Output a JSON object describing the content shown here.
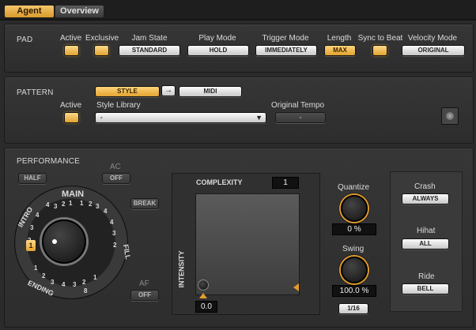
{
  "tabs": {
    "agent": "Agent",
    "overview": "Overview"
  },
  "pad": {
    "section_title": "PAD",
    "active_label": "Active",
    "exclusive_label": "Exclusive",
    "jam_state_label": "Jam State",
    "jam_state_value": "STANDARD",
    "play_mode_label": "Play Mode",
    "play_mode_value": "HOLD",
    "trigger_mode_label": "Trigger Mode",
    "trigger_mode_value": "IMMEDIATELY",
    "length_label": "Length",
    "length_value": "MAX",
    "sync_to_beat_label": "Sync to Beat",
    "velocity_mode_label": "Velocity Mode",
    "velocity_mode_value": "ORIGINAL"
  },
  "pattern": {
    "section_title": "PATTERN",
    "style_button": "STYLE",
    "arrow_icon": "→",
    "midi_button": "MIDI",
    "active_label": "Active",
    "style_library_label": "Style Library",
    "style_library_value": "-",
    "original_tempo_label": "Original Tempo",
    "original_tempo_value": "-"
  },
  "performance": {
    "section_title": "PERFORMANCE",
    "half_button": "HALF",
    "ac_label": "AC",
    "ac_value": "OFF",
    "main_label": "MAIN",
    "intro_label": "INTRO",
    "fill_label": "FILL",
    "ending_label": "ENDING",
    "break_button": "BREAK",
    "af_label": "AF",
    "af_value": "OFF",
    "intro_numbers": [
      "4",
      "3",
      "2",
      "1"
    ],
    "main_numbers": [
      "4",
      "3",
      "2",
      "1",
      "1",
      "2",
      "3",
      "4"
    ],
    "fill_numbers": [
      "4",
      "3",
      "2"
    ],
    "ending_numbers": [
      "1",
      "2",
      "3",
      "4",
      "3",
      "2",
      "1",
      "8"
    ],
    "selected_number": "1",
    "complexity_label": "COMPLEXITY",
    "complexity_value": "1",
    "intensity_label": "INTENSITY",
    "intensity_value": "0.0",
    "quantize_label": "Quantize",
    "quantize_value": "0 %",
    "swing_label": "Swing",
    "swing_value": "100.0 %",
    "swing_grid": "1/16",
    "crash_label": "Crash",
    "crash_value": "ALWAYS",
    "hihat_label": "Hihat",
    "hihat_value": "ALL",
    "ride_label": "Ride",
    "ride_value": "BELL"
  },
  "colors": {
    "accent": "#e39b2c",
    "background": "#2b2b2b"
  }
}
